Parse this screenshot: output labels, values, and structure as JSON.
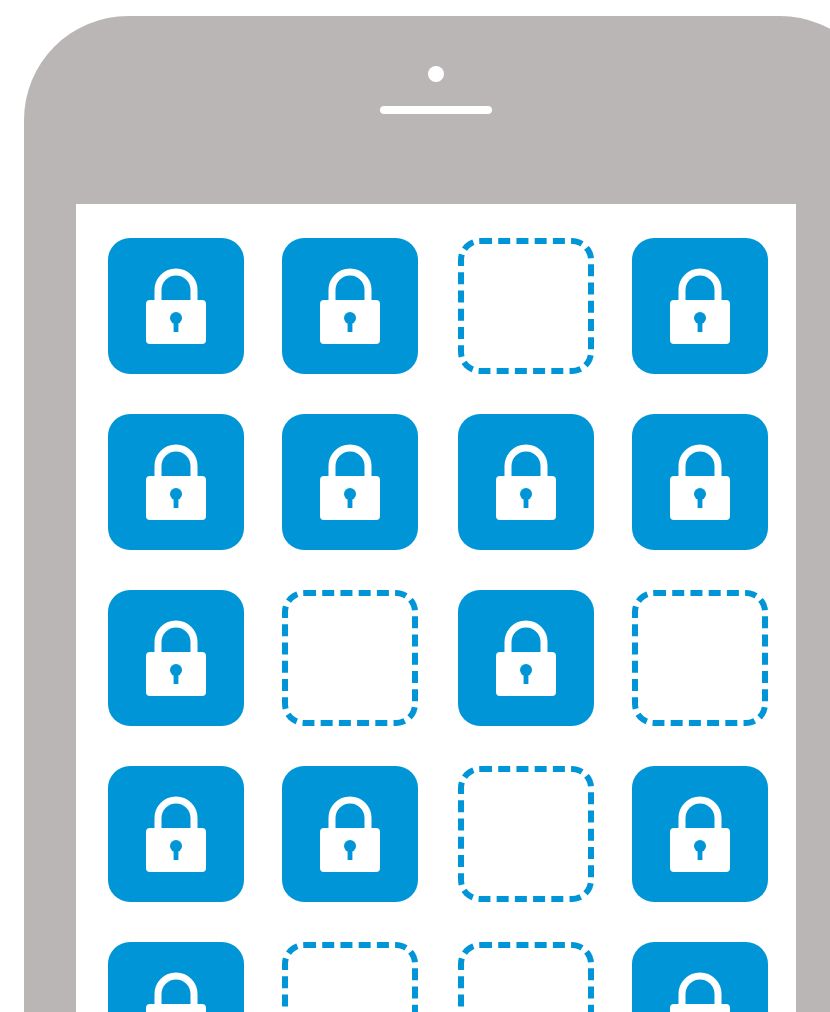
{
  "phone": {
    "screen": {
      "rows": [
        {
          "slots": [
            {
              "kind": "locked"
            },
            {
              "kind": "locked"
            },
            {
              "kind": "empty"
            },
            {
              "kind": "locked"
            }
          ]
        },
        {
          "slots": [
            {
              "kind": "locked"
            },
            {
              "kind": "locked"
            },
            {
              "kind": "locked"
            },
            {
              "kind": "locked"
            }
          ]
        },
        {
          "slots": [
            {
              "kind": "locked"
            },
            {
              "kind": "empty"
            },
            {
              "kind": "locked"
            },
            {
              "kind": "empty"
            }
          ]
        },
        {
          "slots": [
            {
              "kind": "locked"
            },
            {
              "kind": "locked"
            },
            {
              "kind": "empty"
            },
            {
              "kind": "locked"
            }
          ]
        },
        {
          "slots": [
            {
              "kind": "locked"
            },
            {
              "kind": "empty"
            },
            {
              "kind": "empty"
            },
            {
              "kind": "locked"
            }
          ]
        }
      ]
    }
  }
}
